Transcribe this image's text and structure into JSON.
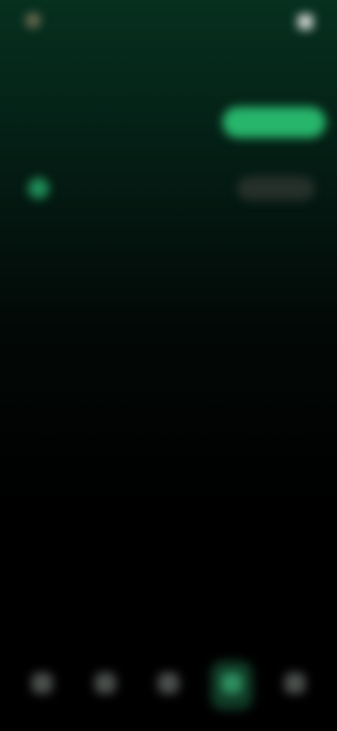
{
  "header": {
    "brand_name": "",
    "brand_icon": "logo-icon",
    "title": "",
    "subtitle": "",
    "action_label": "",
    "action_icon": "app-icon"
  },
  "tabs": [
    {
      "label": "",
      "active": false
    },
    {
      "label": "",
      "active": false
    },
    {
      "label": "",
      "active": true
    }
  ],
  "list": {
    "items": [
      {
        "icon": "status-dot-icon",
        "title": "",
        "subtitle": "",
        "action_label": ""
      }
    ]
  },
  "bottom_nav": {
    "items": [
      {
        "icon": "home-icon",
        "label": "",
        "active": false
      },
      {
        "icon": "explore-icon",
        "label": "",
        "active": false
      },
      {
        "icon": "center-icon",
        "label": "",
        "active": false
      },
      {
        "icon": "active-tab-icon",
        "label": "",
        "active": true
      },
      {
        "icon": "profile-icon",
        "label": "",
        "active": false
      }
    ]
  },
  "colors": {
    "accent": "#27b56b",
    "background_top": "#06301f",
    "background_bottom": "#000000"
  }
}
